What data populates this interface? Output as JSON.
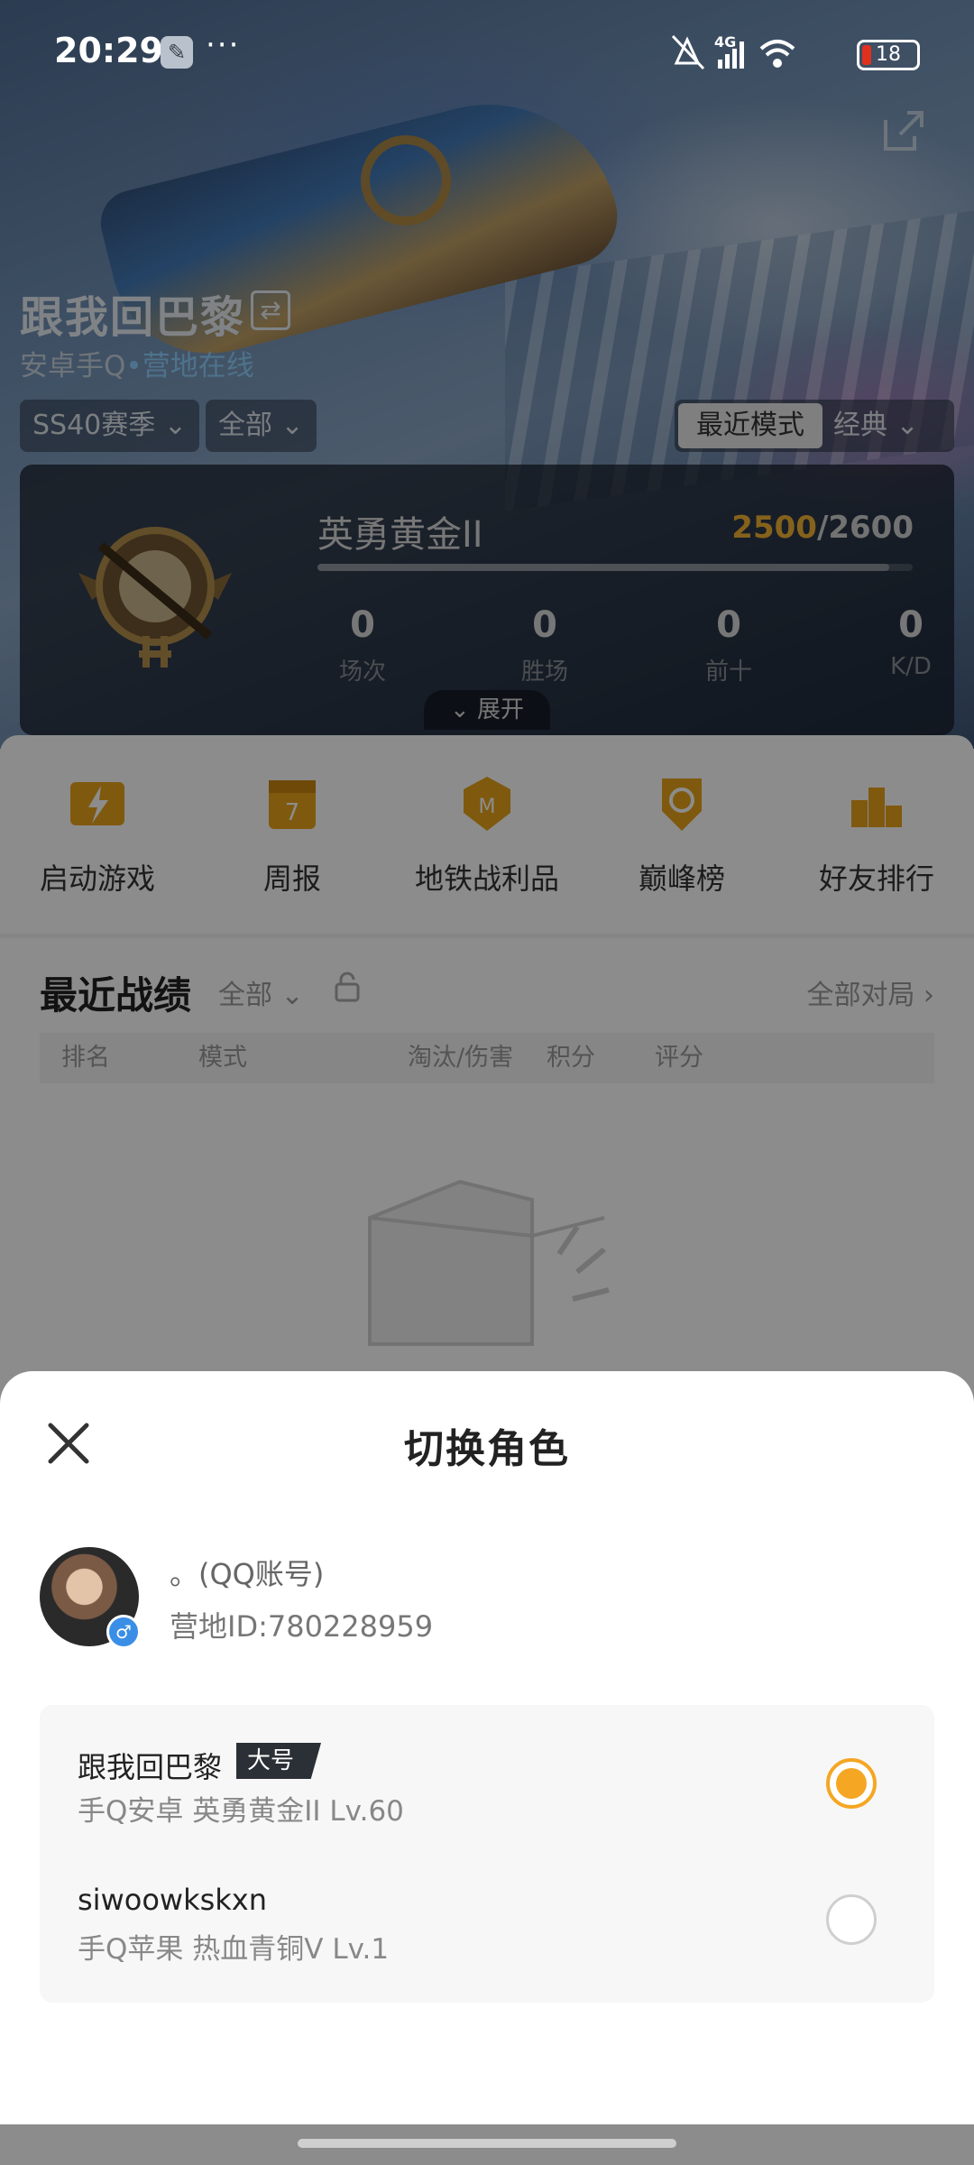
{
  "status_bar": {
    "time": "20:29",
    "more": "···",
    "network": "4G",
    "battery": "18",
    "icons": [
      "wrench-icon",
      "mute-icon",
      "signal-icon",
      "wifi-icon",
      "battery-icon"
    ]
  },
  "header": {
    "player_name": "跟我回巴黎",
    "platform": "安卓手Q",
    "status": "营地在线",
    "season_filter": "SS40赛季",
    "scope_filter": "全部",
    "mode_active": "最近模式",
    "mode_other": "经典"
  },
  "rank": {
    "name": "英勇黄金II",
    "score_current": "2500",
    "score_sep": "/",
    "score_max": "2600",
    "progress_fraction": 0.96,
    "stats": [
      {
        "value": "0",
        "label": "场次"
      },
      {
        "value": "0",
        "label": "胜场"
      },
      {
        "value": "0",
        "label": "前十"
      },
      {
        "value": "0",
        "label": "K/D"
      }
    ],
    "expand_label": "展开"
  },
  "shortcuts": [
    {
      "label": "启动游戏",
      "icon": "launch-game-icon"
    },
    {
      "label": "周报",
      "icon": "weekly-report-icon"
    },
    {
      "label": "地铁战利品",
      "icon": "metro-loot-icon"
    },
    {
      "label": "巅峰榜",
      "icon": "peak-ranking-icon"
    },
    {
      "label": "好友排行",
      "icon": "friend-ranking-icon"
    }
  ],
  "recent": {
    "title": "最近战绩",
    "filter": "全部",
    "all_matches": "全部对局",
    "columns": [
      "排名",
      "模式",
      "淘汰/伤害",
      "积分",
      "评分"
    ]
  },
  "sheet": {
    "title": "切换角色",
    "account_name": "。(QQ账号)",
    "account_id": "营地ID:780228959",
    "roles": [
      {
        "name": "跟我回巴黎",
        "tag": "大号",
        "detail": "手Q安卓  英勇黄金II  Lv.60",
        "selected": true
      },
      {
        "name": "siwoowkskxn",
        "tag": "",
        "detail": "手Q苹果  热血青铜V  Lv.1",
        "selected": false
      }
    ]
  },
  "colors": {
    "accent": "#f5a623",
    "gold_score": "#f2b233",
    "online": "#8fd0ff"
  }
}
